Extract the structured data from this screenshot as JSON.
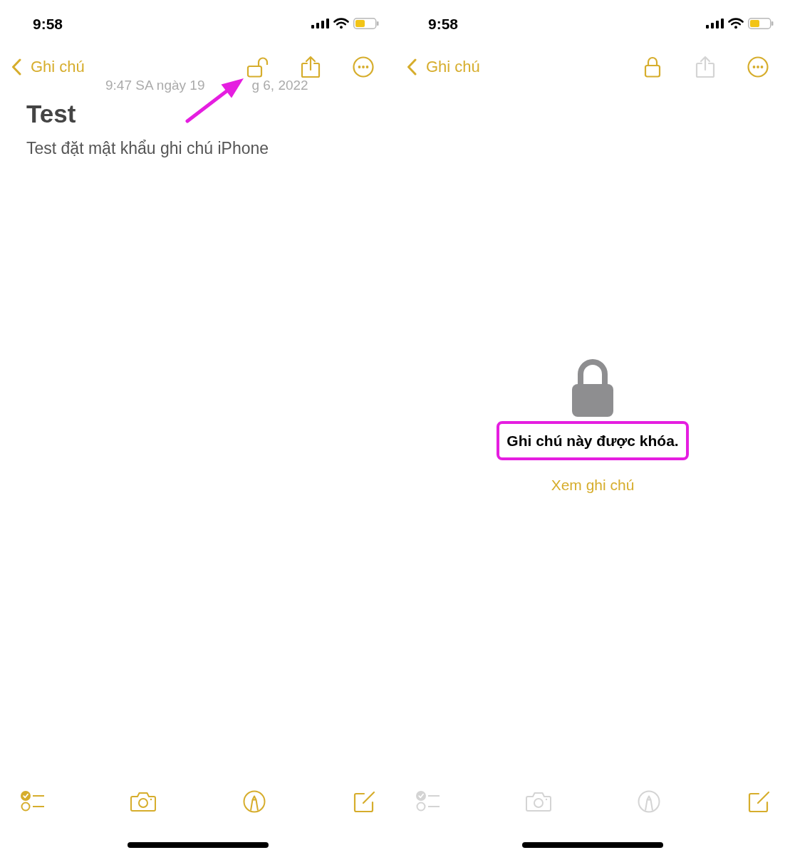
{
  "screens": [
    {
      "status_bar": {
        "time": "9:58"
      },
      "nav_bar": {
        "back_label": "Ghi chú",
        "actions": [
          {
            "kind": "lock",
            "locked": false,
            "disabled": false
          },
          {
            "kind": "share",
            "disabled": false
          },
          {
            "kind": "more",
            "disabled": false
          }
        ]
      },
      "note": {
        "date_parts": [
          "9:47 SA ngày 19",
          "g 6, 2022"
        ],
        "title": "Test",
        "body": "Test đặt mật khẩu ghi chú iPhone"
      },
      "toolbar": [
        {
          "kind": "checklist",
          "disabled": false
        },
        {
          "kind": "camera",
          "disabled": false
        },
        {
          "kind": "markup",
          "disabled": false
        },
        {
          "kind": "compose",
          "disabled": false
        }
      ],
      "annotation": {
        "kind": "arrow"
      }
    },
    {
      "status_bar": {
        "time": "9:58"
      },
      "nav_bar": {
        "back_label": "Ghi chú",
        "actions": [
          {
            "kind": "lock",
            "locked": true,
            "disabled": false
          },
          {
            "kind": "share",
            "disabled": true
          },
          {
            "kind": "more",
            "disabled": false
          }
        ]
      },
      "locked_view": {
        "message": "Ghi chú này được khóa.",
        "link": "Xem ghi chú"
      },
      "toolbar": [
        {
          "kind": "checklist",
          "disabled": true
        },
        {
          "kind": "camera",
          "disabled": true
        },
        {
          "kind": "markup",
          "disabled": true
        },
        {
          "kind": "compose",
          "disabled": false
        }
      ],
      "annotation": {
        "kind": "frame"
      }
    }
  ]
}
